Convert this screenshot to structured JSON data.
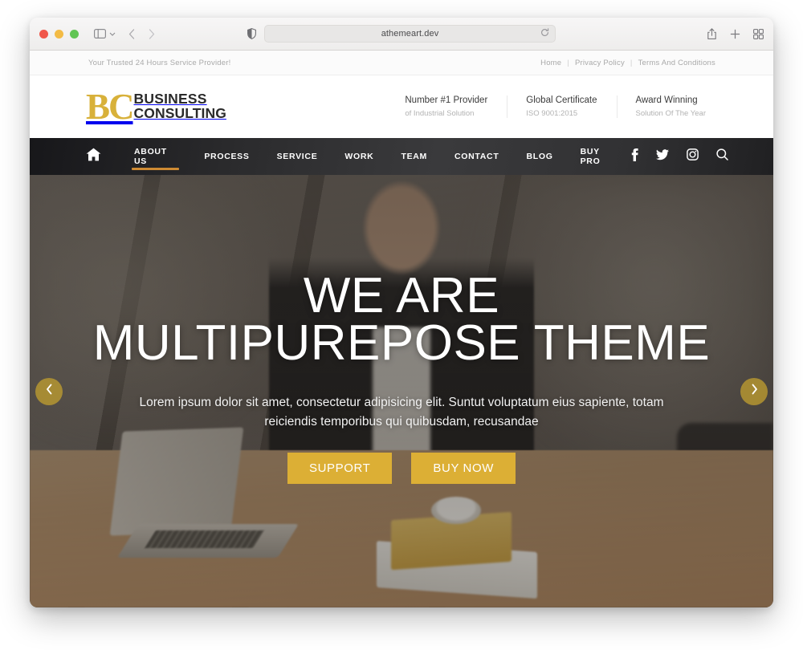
{
  "browser": {
    "url": "athemeart.dev",
    "icons": {
      "sidebar": "sidebar-icon",
      "chevron": "chevron-down-icon",
      "back": "back-arrow-icon",
      "forward": "forward-arrow-icon",
      "shield": "privacy-shield-icon",
      "reload": "reload-icon",
      "share": "share-icon",
      "newtab": "plus-icon",
      "tabs": "tab-overview-icon"
    }
  },
  "topbar": {
    "tagline": "Your Trusted 24 Hours Service Provider!",
    "links": [
      "Home",
      "Privacy Policy",
      "Terms And Conditions"
    ],
    "separator": "|"
  },
  "header": {
    "logo": {
      "mark": "BC",
      "line1": "BUSINESS",
      "line2": "CONSULTING"
    },
    "features": [
      {
        "title": "Number #1 Provider",
        "sub": "of Industrial Solution"
      },
      {
        "title": "Global Certificate",
        "sub": "ISO 9001:2015"
      },
      {
        "title": "Award Winning",
        "sub": "Solution Of The Year"
      }
    ]
  },
  "nav": {
    "home_icon": "home-icon",
    "items": [
      {
        "label": "ABOUT US",
        "active": true
      },
      {
        "label": "PROCESS",
        "active": false
      },
      {
        "label": "SERVICE",
        "active": false
      },
      {
        "label": "WORK",
        "active": false
      },
      {
        "label": "TEAM",
        "active": false
      },
      {
        "label": "CONTACT",
        "active": false
      },
      {
        "label": "BLOG",
        "active": false
      },
      {
        "label": "BUY PRO",
        "active": false
      }
    ],
    "social": [
      "facebook-icon",
      "twitter-icon",
      "instagram-icon",
      "search-icon"
    ]
  },
  "hero": {
    "heading_line1": "WE ARE",
    "heading_line2": "MULTIPUREPOSE THEME",
    "subtext": "Lorem ipsum dolor sit amet, consectetur adipisicing elit. Suntut voluptatum eius sapiente, totam reiciendis temporibus qui quibusdam, recusandae",
    "buttons": [
      {
        "label": "SUPPORT"
      },
      {
        "label": "BUY NOW"
      }
    ],
    "prev_arrow": "chevron-left-icon",
    "next_arrow": "chevron-right-icon"
  },
  "colors": {
    "gold": "#dcaf35",
    "logo_gold": "#d8b13a",
    "nav_accent": "#cf8b33",
    "nav_bg": "#2b2b2d"
  }
}
